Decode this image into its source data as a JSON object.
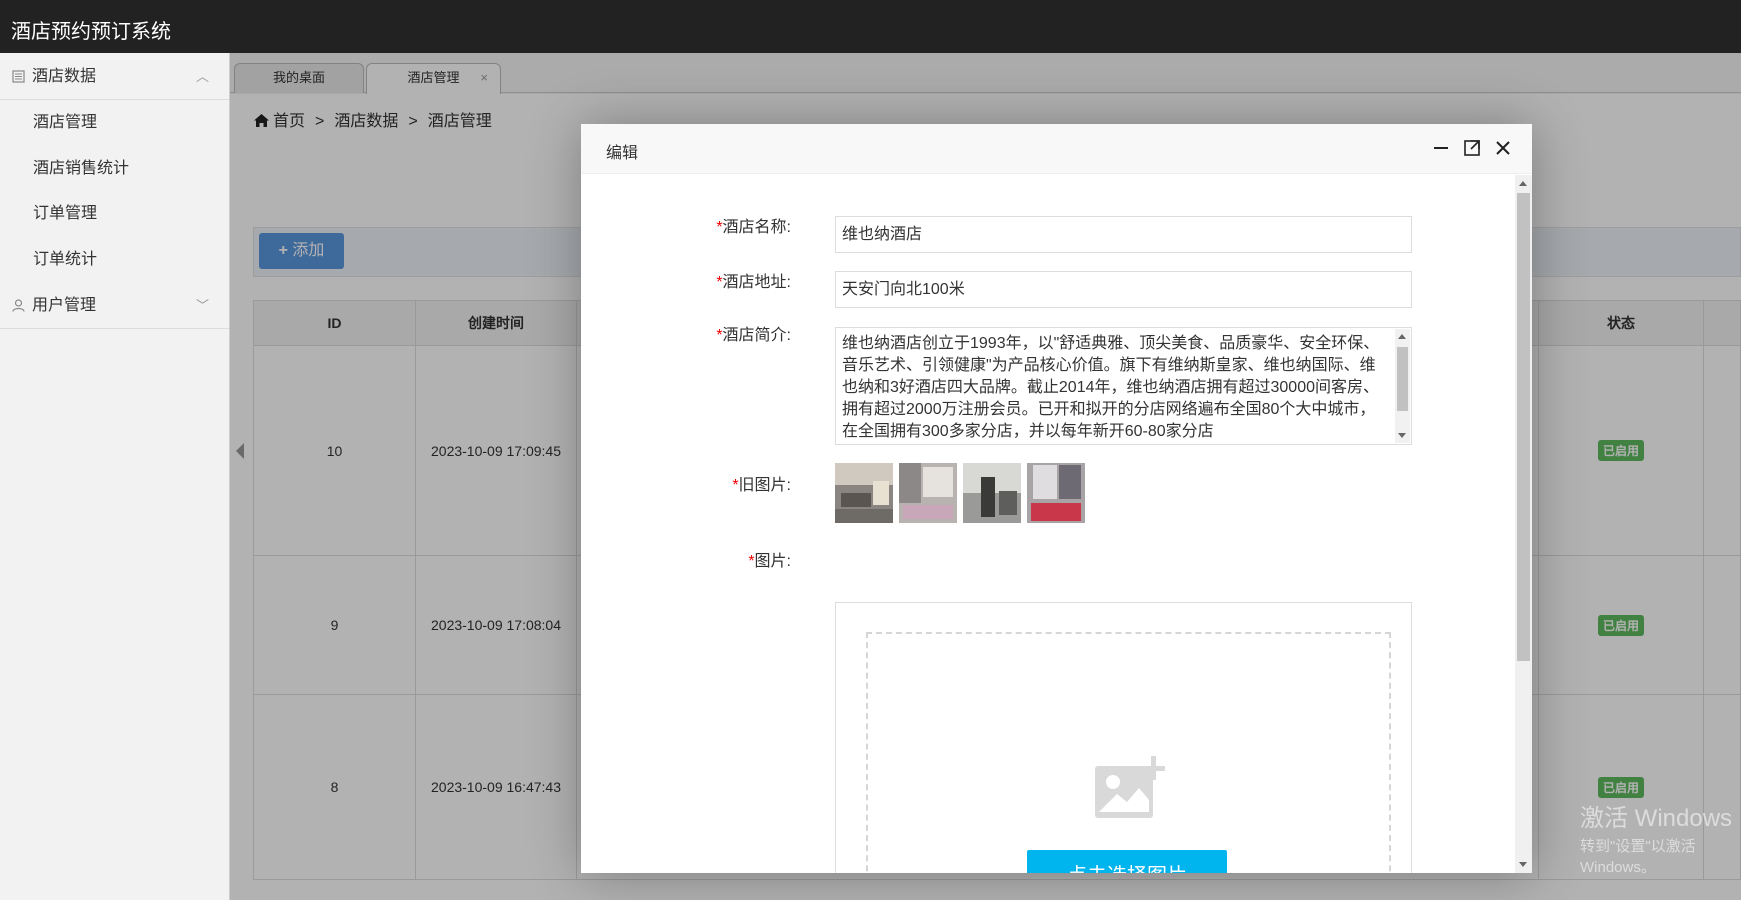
{
  "app": {
    "title": "酒店预约预订系统"
  },
  "sidebar": {
    "groups": [
      {
        "label": "酒店数据",
        "icon": "book-icon",
        "expanded": true,
        "items": [
          {
            "label": "酒店管理"
          },
          {
            "label": "酒店销售统计"
          },
          {
            "label": "订单管理"
          },
          {
            "label": "订单统计"
          }
        ]
      },
      {
        "label": "用户管理",
        "icon": "user-icon",
        "expanded": false
      }
    ]
  },
  "tabs": [
    {
      "label": "我的桌面",
      "active": false
    },
    {
      "label": "酒店管理",
      "active": true,
      "close": "×"
    }
  ],
  "breadcrumb": {
    "home": "首页",
    "sep": ">",
    "level1": "酒店数据",
    "level2": "酒店管理"
  },
  "toolbar": {
    "add_label": "添加",
    "add_icon": "plus-icon"
  },
  "table": {
    "headers": {
      "id": "ID",
      "created": "创建时间",
      "status": "状态"
    },
    "rows": [
      {
        "id": "10",
        "created": "2023-10-09 17:09:45",
        "status": "已启用"
      },
      {
        "id": "9",
        "created": "2023-10-09 17:08:04",
        "status": "已启用"
      },
      {
        "id": "8",
        "created": "2023-10-09 16:47:43",
        "status": "已启用"
      }
    ]
  },
  "watermark": {
    "line1": "激活 Windows",
    "line2": "转到\"设置\"以激活 Windows。"
  },
  "modal": {
    "title": "编辑",
    "controls": {
      "minimize": "minimize-icon",
      "maximize": "maximize-icon",
      "close": "close-icon"
    },
    "required_mark": "*",
    "fields": {
      "name_label": "酒店名称:",
      "name_value": "维也纳酒店",
      "address_label": "酒店地址:",
      "address_value": "天安门向北100米",
      "intro_label": "酒店简介:",
      "intro_value": "维也纳酒店创立于1993年，以\"舒适典雅、顶尖美食、品质豪华、安全环保、音乐艺术、引领健康\"为产品核心价值。旗下有维纳斯皇家、维也纳国际、维也纳和3好酒店四大品牌。截止2014年，维也纳酒店拥有超过30000间客房、拥有超过2000万注册会员。已开和拟开的分店网络遍布全国80个大中城市，在全国拥有300多家分店，并以每年新开60-80家分店",
      "old_images_label": "旧图片:",
      "image_label": "图片:",
      "pick_button": "点击选择图片"
    }
  },
  "colors": {
    "header_bg": "#222222",
    "add_button": "#5a98de",
    "pick_button": "#00b4ee",
    "badge": "#5eb95e",
    "required": "#ee0000"
  }
}
